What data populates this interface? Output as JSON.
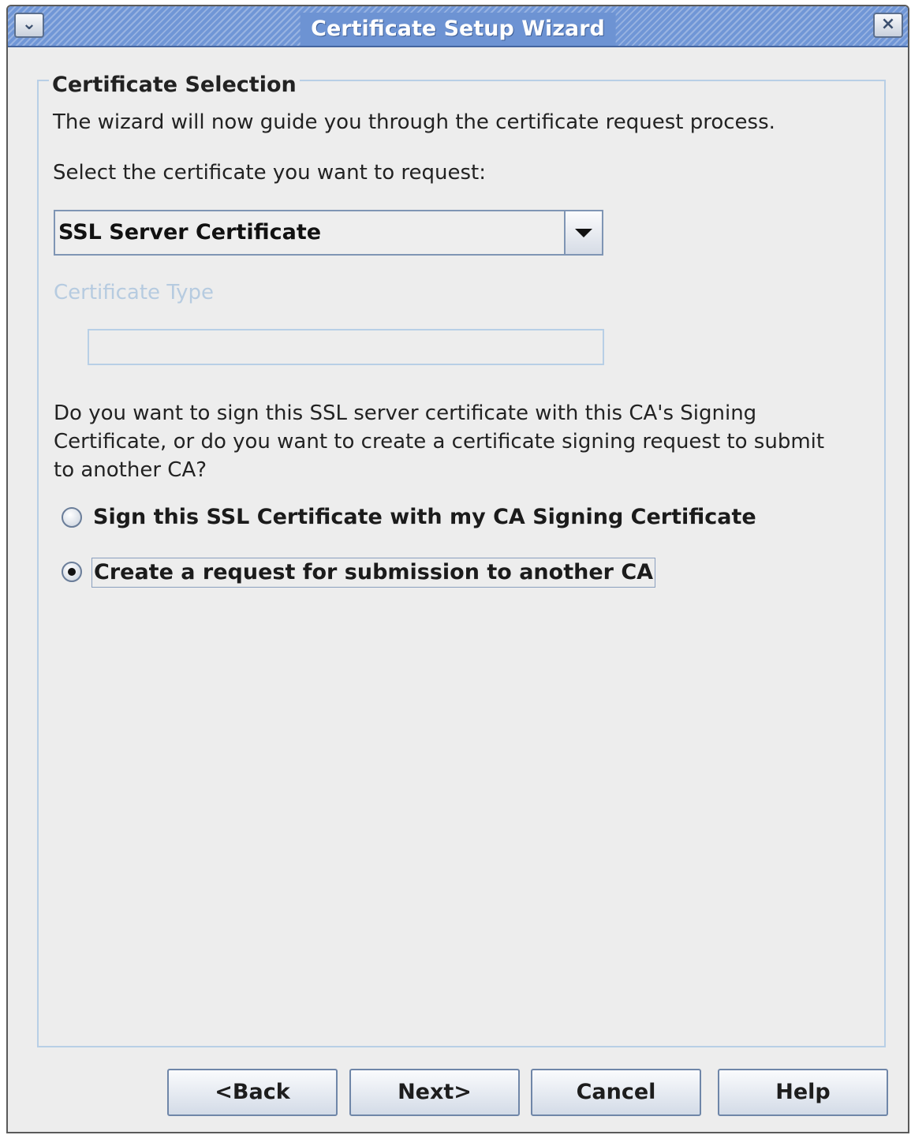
{
  "window": {
    "title": "Certificate Setup Wizard",
    "menu_glyph": "⌄",
    "close_glyph": "×"
  },
  "section": {
    "title": "Certificate Selection",
    "intro": "The wizard will now guide you through the certificate request process.",
    "select_prompt": "Select the certificate you want to request:"
  },
  "certificate_combo": {
    "value": "SSL Server Certificate"
  },
  "certificate_type": {
    "label": "Certificate Type",
    "value": ""
  },
  "question": {
    "line1": "Do you want to sign this SSL server certificate with this CA's Signing",
    "line2": "Certificate, or do you want to create a certificate signing request to submit",
    "line3": "to another CA?"
  },
  "options": [
    {
      "label": "Sign this SSL Certificate with my CA Signing Certificate",
      "selected": false
    },
    {
      "label": "Create a request for submission to another CA",
      "selected": true
    }
  ],
  "buttons": {
    "back": "<Back",
    "next": "Next>",
    "cancel": "Cancel",
    "help": "Help"
  },
  "icons": {
    "window_menu": "chevron-down-icon",
    "window_close": "close-icon",
    "combo_arrow": "caret-down-icon"
  },
  "colors": {
    "titlebar": "#7096d6",
    "window_background": "#ededed",
    "group_border": "#b8cfe6",
    "disabled_text": "#b6cbe0"
  }
}
